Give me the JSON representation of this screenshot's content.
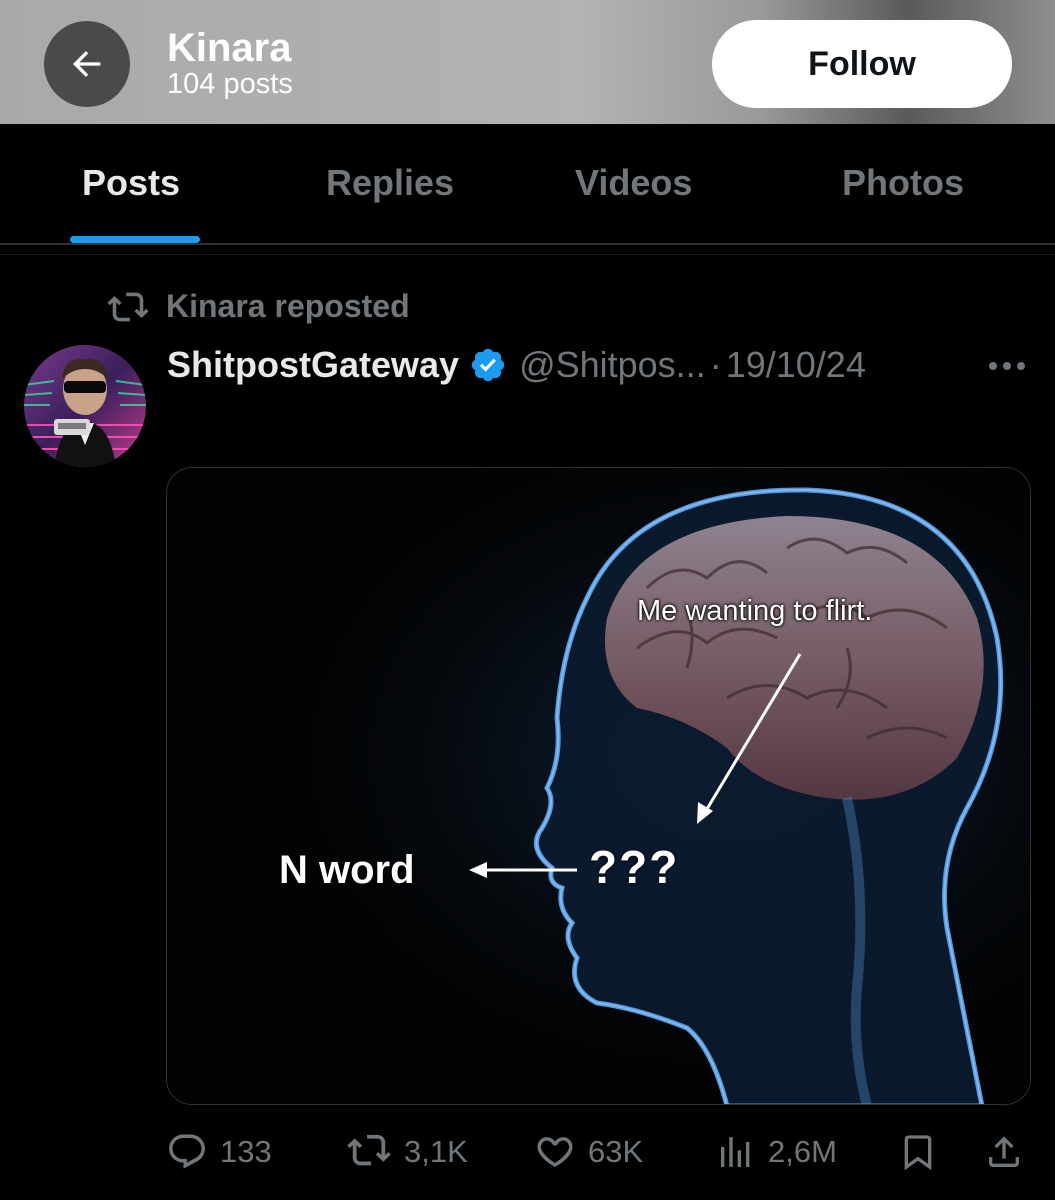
{
  "header": {
    "title": "Kinara",
    "subtitle": "104 posts",
    "follow_label": "Follow"
  },
  "tabs": [
    {
      "label": "Posts",
      "active": true
    },
    {
      "label": "Replies",
      "active": false
    },
    {
      "label": "Videos",
      "active": false
    },
    {
      "label": "Photos",
      "active": false
    }
  ],
  "post": {
    "repost_label": "Kinara reposted",
    "author": "ShitpostGateway",
    "verified": true,
    "handle": "@Shitpos...",
    "separator": "·",
    "date": "19/10/24",
    "media": {
      "caption_top": "Me wanting to flirt.",
      "caption_left": "N word",
      "caption_center": "???"
    },
    "actions": {
      "replies": "133",
      "reposts": "3,1K",
      "likes": "63K",
      "views": "2,6M"
    }
  },
  "icons": {
    "back": "arrow-left-icon",
    "repost": "repost-icon",
    "verified": "verified-badge-icon",
    "more": "more-dots-icon",
    "reply": "reply-icon",
    "like": "heart-icon",
    "views": "views-chart-icon",
    "bookmark": "bookmark-icon",
    "share": "share-icon"
  },
  "colors": {
    "accent": "#1d9bf0",
    "muted": "#71767b",
    "text": "#e7e9ea",
    "background": "#000000"
  }
}
